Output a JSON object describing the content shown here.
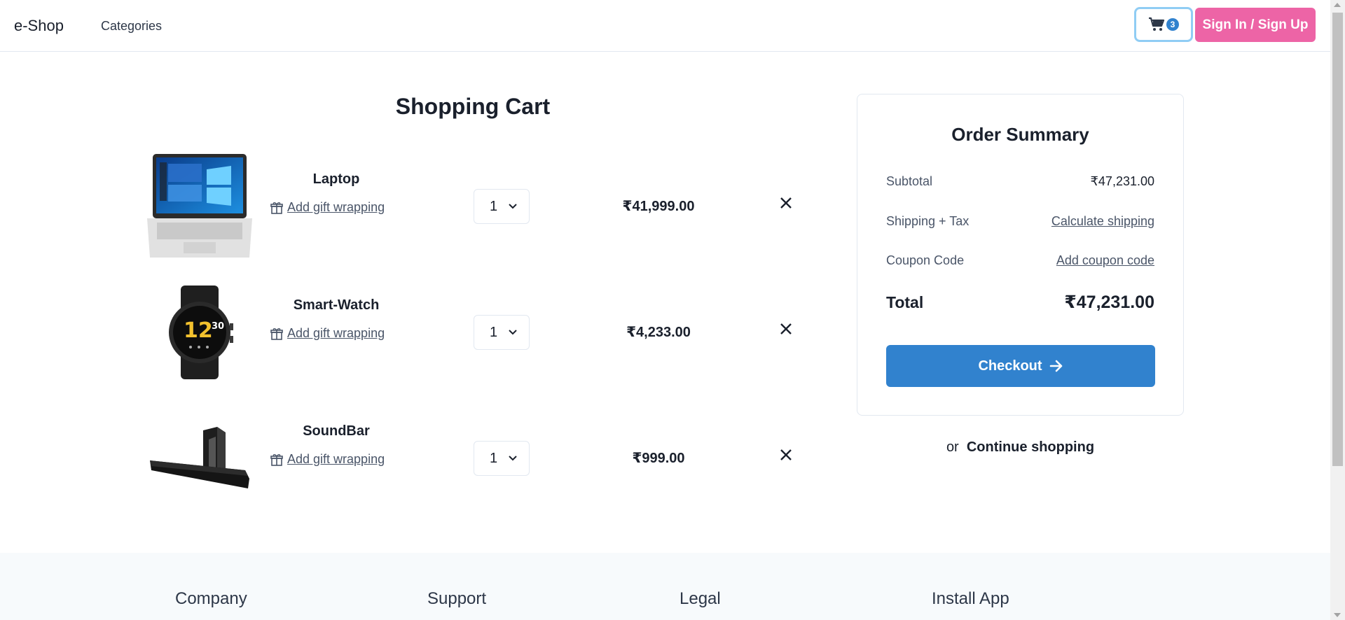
{
  "header": {
    "brand": "e-Shop",
    "nav_categories": "Categories",
    "cart_count": "3",
    "sign_in_label": "Sign In / Sign Up"
  },
  "cart": {
    "title": "Shopping Cart",
    "gift_label": "Add gift wrapping",
    "items": [
      {
        "name": "Laptop",
        "qty": "1",
        "price": "₹41,999.00",
        "image": "laptop-image"
      },
      {
        "name": "Smart-Watch",
        "qty": "1",
        "price": "₹4,233.00",
        "image": "smartwatch-image"
      },
      {
        "name": "SoundBar",
        "qty": "1",
        "price": "₹999.00",
        "image": "soundbar-image"
      }
    ]
  },
  "summary": {
    "title": "Order Summary",
    "subtotal_label": "Subtotal",
    "subtotal_value": "₹47,231.00",
    "shipping_label": "Shipping + Tax",
    "shipping_link": "Calculate shipping",
    "coupon_label": "Coupon Code",
    "coupon_link": "Add coupon code",
    "total_label": "Total",
    "total_value": "₹47,231.00",
    "checkout_label": "Checkout",
    "continue_prefix": "or",
    "continue_link": "Continue shopping"
  },
  "footer": {
    "col1": "Company",
    "col2": "Support",
    "col3": "Legal",
    "col4": "Install App"
  },
  "colors": {
    "accent": "#3182ce",
    "signin": "#ed64a6",
    "cart_focus": "#90cdf4"
  }
}
